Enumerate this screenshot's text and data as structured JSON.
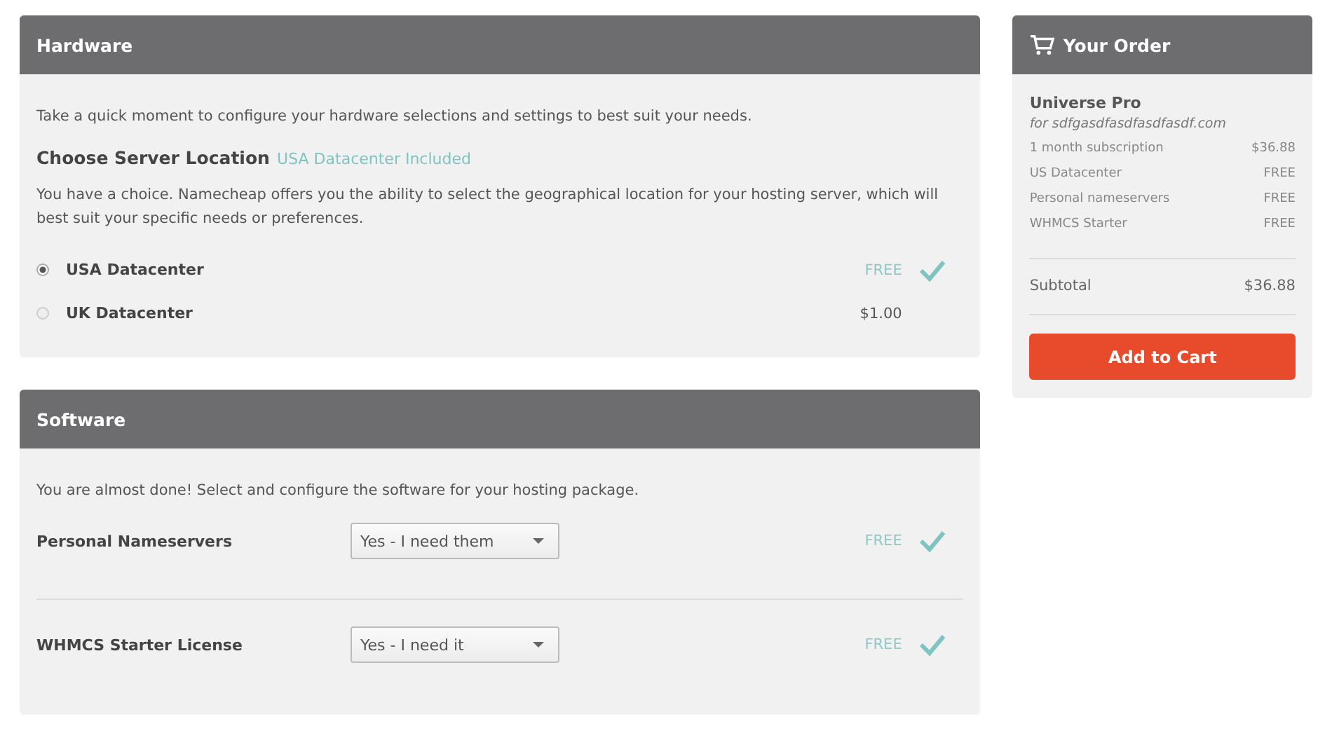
{
  "hardware": {
    "title": "Hardware",
    "intro": "Take a quick moment to configure your hardware selections and settings to best suit your needs.",
    "location_heading": "Choose Server Location",
    "location_note": "USA Datacenter Included",
    "description": "You have a choice. Namecheap offers you the ability to select the geographical location for your hosting server, which will best suit your specific needs or preferences.",
    "options": [
      {
        "label": "USA Datacenter",
        "price": "FREE",
        "selected": true
      },
      {
        "label": "UK Datacenter",
        "price": "$1.00",
        "selected": false
      }
    ]
  },
  "software": {
    "title": "Software",
    "intro": "You are almost done! Select and configure the software for your hosting package.",
    "rows": [
      {
        "label": "Personal Nameservers",
        "value": "Yes - I need them",
        "price": "FREE"
      },
      {
        "label": "WHMCS Starter License",
        "value": "Yes - I need it",
        "price": "FREE"
      }
    ]
  },
  "order": {
    "title": "Your Order",
    "product": "Universe Pro",
    "domain": "for sdfgasdfasdfasdfasdf.com",
    "items": [
      {
        "name": "1 month subscription",
        "price": "$36.88"
      },
      {
        "name": "US Datacenter",
        "price": "FREE"
      },
      {
        "name": "Personal nameservers",
        "price": "FREE"
      },
      {
        "name": "WHMCS Starter",
        "price": "FREE"
      }
    ],
    "subtotal_label": "Subtotal",
    "subtotal": "$36.88",
    "button": "Add to Cart"
  }
}
